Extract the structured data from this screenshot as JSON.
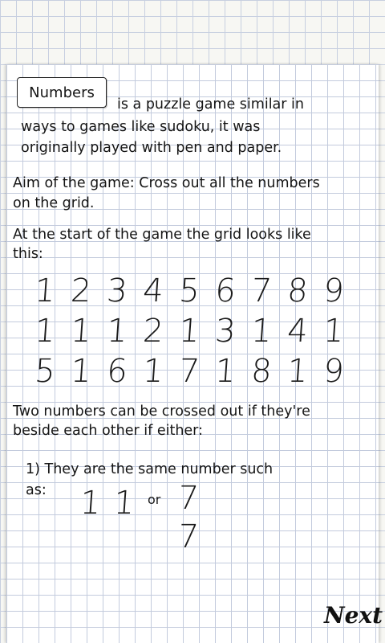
{
  "title_word": "Numbers",
  "intro": [
    "is a puzzle game similar in",
    "ways to games like sudoku, it was",
    "originally played with pen and paper."
  ],
  "aim": [
    "Aim of the game: Cross out all the numbers",
    "on the grid."
  ],
  "start": [
    "At the start of the game the grid looks like",
    "this:"
  ],
  "grid_rows": [
    [
      "1",
      "2",
      "3",
      "4",
      "5",
      "6",
      "7",
      "8",
      "9"
    ],
    [
      "1",
      "1",
      "1",
      "2",
      "1",
      "3",
      "1",
      "4",
      "1"
    ],
    [
      "5",
      "1",
      "6",
      "1",
      "7",
      "1",
      "8",
      "1",
      "9"
    ]
  ],
  "rule_intro": [
    "Two numbers can be crossed out if they're",
    "beside each other if either:"
  ],
  "rule1": [
    "1) They are the same number such",
    "as:"
  ],
  "example": {
    "left1": "1",
    "left2": "1",
    "or": "or",
    "top": "7",
    "bottom": "7"
  },
  "next_label": "Next"
}
